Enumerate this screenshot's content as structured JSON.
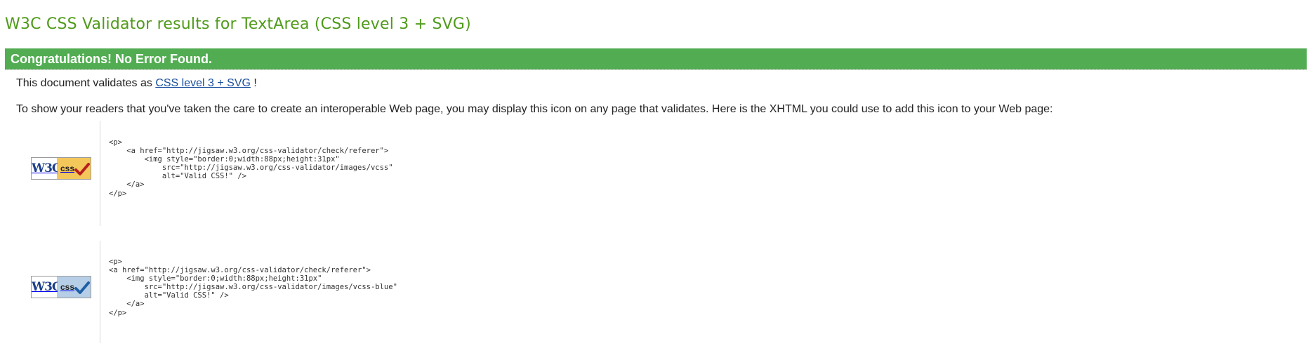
{
  "page_title": "W3C CSS Validator results for TextArea (CSS level 3 + SVG)",
  "congrats": "Congratulations! No Error Found.",
  "validates": {
    "prefix": "This document validates as ",
    "link_text": "CSS level 3 + SVG",
    "suffix": " !"
  },
  "intro": "To show your readers that you've taken the care to create an interoperable Web page, you may display this icon on any page that validates. Here is the XHTML you could use to add this icon to your Web page:",
  "badges": [
    {
      "w3c_text": "W3C",
      "css_text": "css",
      "variant": "gold",
      "check_color": "#b81e1e",
      "code": "<p>\n    <a href=\"http://jigsaw.w3.org/css-validator/check/referer\">\n        <img style=\"border:0;width:88px;height:31px\"\n            src=\"http://jigsaw.w3.org/css-validator/images/vcss\"\n            alt=\"Valid CSS!\" />\n    </a>\n</p>"
    },
    {
      "w3c_text": "W3C",
      "css_text": "css",
      "variant": "blue",
      "check_color": "#1f5fa8",
      "code": "<p>\n<a href=\"http://jigsaw.w3.org/css-validator/check/referer\">\n    <img style=\"border:0;width:88px;height:31px\"\n        src=\"http://jigsaw.w3.org/css-validator/images/vcss-blue\"\n        alt=\"Valid CSS!\" />\n    </a>\n</p>"
    }
  ],
  "colors": {
    "title_green": "#4f9a1a",
    "bar_green": "#52ad52",
    "link_blue": "#1a4f9c"
  }
}
